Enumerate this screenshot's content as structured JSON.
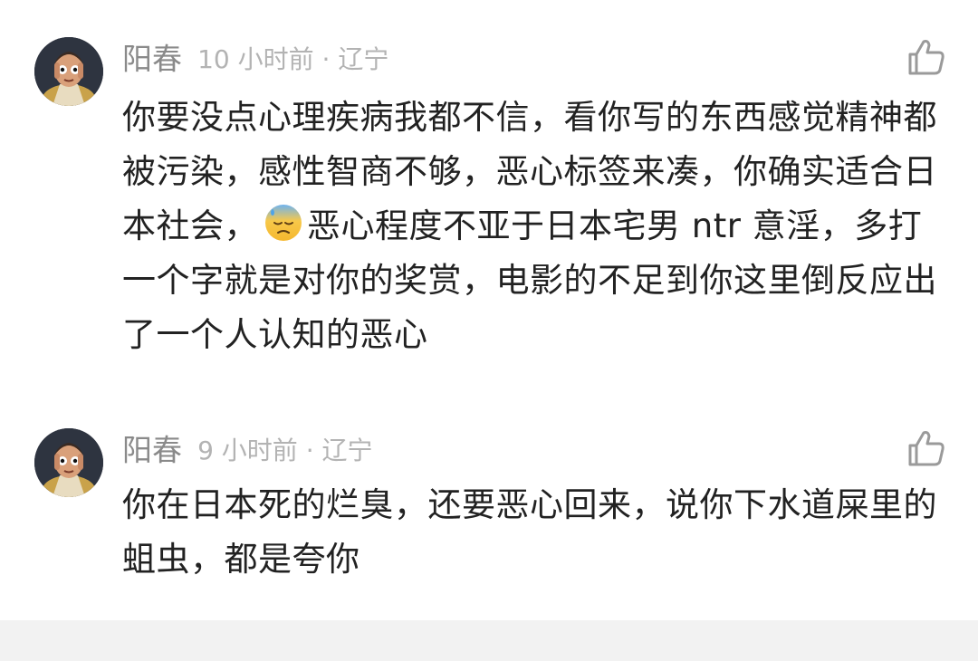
{
  "comments": [
    {
      "username": "阳春",
      "time_location": "10 小时前 · 辽宁",
      "text_before_emoji": "你要没点心理疾病我都不信，看你写的东西感觉精神都被污染，感性智商不够，恶心标签来凑，你确实适合日本社会，",
      "emoji_icon": "downcast-face-with-sweat-icon",
      "text_after_emoji": "恶心程度不亚于日本宅男 ntr 意淫，多打一个字就是对你的奖赏，电影的不足到你这里倒反应出了一个人认知的恶心"
    },
    {
      "username": "阳春",
      "time_location": "9 小时前 · 辽宁",
      "text": "你在日本死的烂臭，还要恶心回来，说你下水道屎里的蛆虫，都是夸你"
    }
  ],
  "icons": {
    "like": "thumbs-up-icon",
    "avatar": "avatar-image"
  },
  "colors": {
    "username": "#8a8a8a",
    "meta": "#b3b3b3",
    "body": "#222222",
    "footer": "#f2f2f2"
  }
}
